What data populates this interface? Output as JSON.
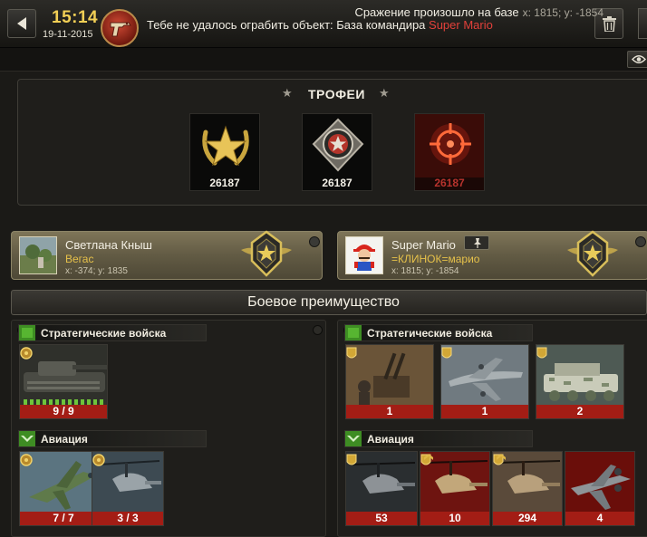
{
  "header": {
    "time": "15:14",
    "date": "19-11-2015",
    "headline_prefix": "Тебе не удалось ограбить объект: База командира ",
    "enemy_name": "Super Mario"
  },
  "location": {
    "label": "Сражение произошло на базе",
    "coords": "x: 1815; y: -1854"
  },
  "trophies": {
    "title": "ТРОФЕИ",
    "items": [
      {
        "icon": "laurel-star-medal-icon",
        "value": "26187"
      },
      {
        "icon": "star-shield-medal-icon",
        "value": "26187"
      },
      {
        "icon": "target-crosshair-icon",
        "value": "26187"
      }
    ]
  },
  "players": [
    {
      "name": "Светлана Кныш",
      "clan": "Вегас",
      "coords": "x: -374; y: 1835",
      "avatar": "landscape-avatar"
    },
    {
      "name": "Super Mario",
      "clan": "=КЛИНОК=марио",
      "coords": "x: 1815; y: -1854",
      "avatar": "mario-avatar"
    }
  ],
  "advantage": {
    "label": "Боевое преимущество"
  },
  "left": {
    "categories": [
      {
        "label": "Стратегические войска",
        "units": [
          {
            "icon": "tank-icon",
            "count": "9 / 9"
          }
        ]
      },
      {
        "label": "Авиация",
        "units": [
          {
            "icon": "fighter-jet-icon",
            "count": "7 / 7"
          },
          {
            "icon": "attack-helicopter-icon",
            "count": "3 / 3"
          }
        ]
      }
    ]
  },
  "right": {
    "categories": [
      {
        "label": "Стратегические войска",
        "units": [
          {
            "icon": "anti-air-gun-icon",
            "count": "1"
          },
          {
            "icon": "cargo-plane-icon",
            "count": "1"
          },
          {
            "icon": "rocket-vehicle-icon",
            "count": "2"
          }
        ]
      },
      {
        "label": "Авиация",
        "units": [
          {
            "icon": "helicopter-icon",
            "count": "53"
          },
          {
            "icon": "desert-helicopter-icon",
            "count": "10"
          },
          {
            "icon": "gunship-helicopter-icon",
            "count": "294"
          },
          {
            "icon": "a10-jet-icon",
            "count": "4"
          }
        ]
      }
    ]
  },
  "colors": {
    "accent_gold": "#f2cf55",
    "enemy_red": "#e2403a",
    "count_bar_red": "#a31d15",
    "clan_gold": "#e6c14a"
  }
}
